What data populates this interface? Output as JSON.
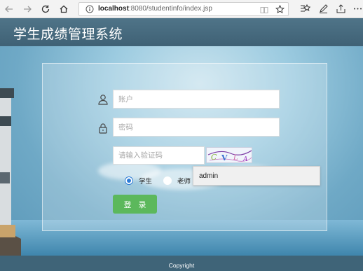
{
  "browser": {
    "url_host": "localhost",
    "url_rest": ":8080/studentinfo/index.jsp"
  },
  "app": {
    "title": "学生成绩管理系统"
  },
  "login": {
    "account_placeholder": "账户",
    "password_placeholder": "密码",
    "captcha_placeholder": "请输入验证码",
    "captcha_chars": [
      "C",
      "V",
      "L",
      "A"
    ],
    "roles": [
      {
        "label": "学生",
        "checked": true
      },
      {
        "label": "老师",
        "checked": false
      }
    ],
    "autocomplete_suggestion": "admin",
    "submit_label": "登录"
  },
  "footer": {
    "text": "Copyright"
  },
  "colors": {
    "header": "#4a6e82",
    "login_button": "#5cb85c",
    "radio_accent": "#2b7bd6"
  },
  "icons": {
    "back": "arrow-left-icon",
    "forward": "arrow-right-icon",
    "refresh": "refresh-icon",
    "home": "home-icon",
    "info": "info-icon",
    "reader": "reading-view-icon",
    "favorite": "star-icon",
    "favorites_list": "favorites-list-icon",
    "notes": "pen-icon",
    "share": "share-icon",
    "more": "more-icon",
    "user": "user-icon",
    "lock": "lock-icon"
  }
}
